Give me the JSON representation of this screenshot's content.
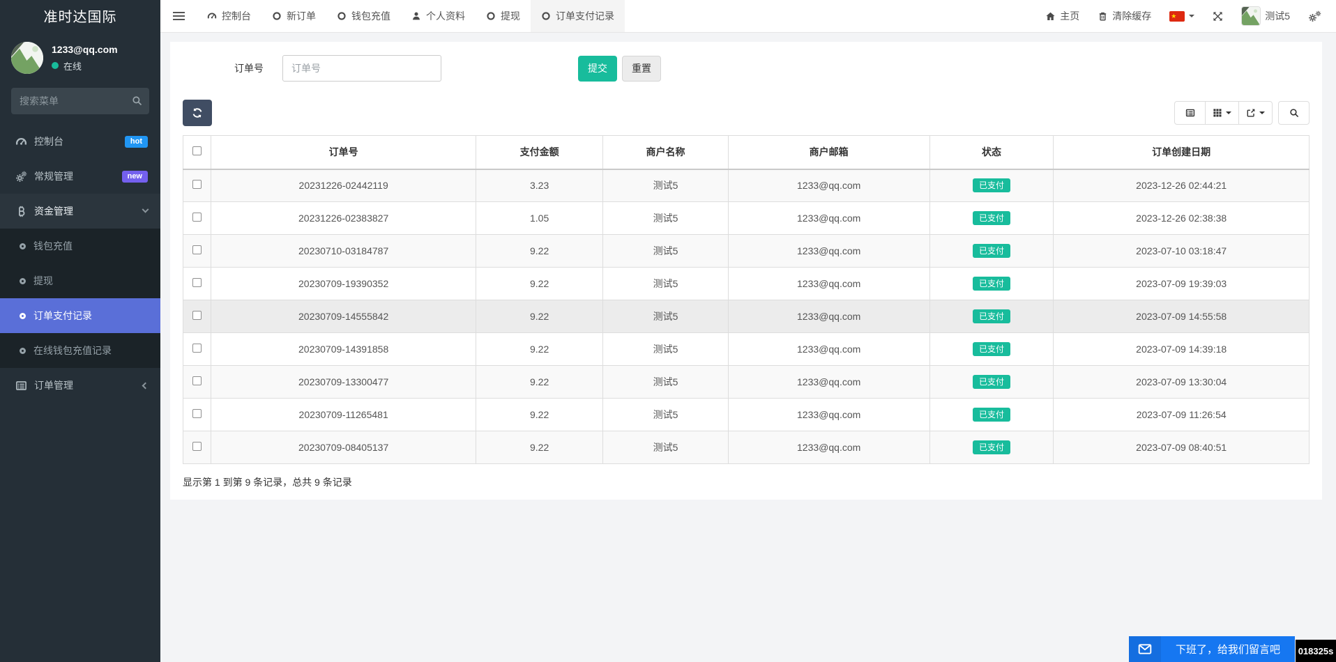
{
  "sidebar": {
    "brand": "准时达国际",
    "user": {
      "name": "1233@qq.com",
      "status": "在线",
      "avatar_icon": "image-placeholder-avatar"
    },
    "search": {
      "placeholder": "搜索菜单",
      "icon": "search-icon"
    },
    "menu": [
      {
        "label": "控制台",
        "icon": "dashboard-icon",
        "badge": "hot",
        "badge_color": "#2196f3"
      },
      {
        "label": "常规管理",
        "icon": "gears-icon",
        "badge": "new",
        "badge_color": "#7460ee"
      },
      {
        "label": "资金管理",
        "icon": "bitcoin-icon",
        "expanded": true
      },
      {
        "label": "订单管理",
        "icon": "order-list-icon",
        "collapsed": true
      }
    ],
    "submenu": [
      {
        "label": "钱包充值",
        "icon": "circle-icon"
      },
      {
        "label": "提现",
        "icon": "circle-icon"
      },
      {
        "label": "订单支付记录",
        "icon": "circle-icon",
        "active": true
      },
      {
        "label": "在线钱包充值记录",
        "icon": "circle-icon"
      }
    ]
  },
  "navbar": {
    "tabs": [
      {
        "label": "控制台",
        "icon": "dashboard-icon"
      },
      {
        "label": "新订单",
        "icon": "circle-icon"
      },
      {
        "label": "钱包充值",
        "icon": "circle-icon"
      },
      {
        "label": "个人资料",
        "icon": "user-icon"
      },
      {
        "label": "提现",
        "icon": "circle-icon"
      },
      {
        "label": "订单支付记录",
        "icon": "circle-icon",
        "active": true
      }
    ],
    "right": {
      "home": {
        "label": "主页",
        "icon": "home-icon"
      },
      "clear_cache": {
        "label": "清除缓存",
        "icon": "trash-icon"
      },
      "language": {
        "icon": "cn-flag-icon",
        "caret": "caret-down-icon"
      },
      "fullscreen": {
        "icon": "fullscreen-expand-icon"
      },
      "user": {
        "label": "测试5",
        "icon": "image-placeholder-avatar"
      },
      "settings": {
        "icon": "gears-icon"
      }
    }
  },
  "filter_form": {
    "label": "订单号",
    "value": "",
    "placeholder": "订单号",
    "submit": "提交",
    "reset": "重置"
  },
  "toolbar": {
    "refresh": {
      "icon": "refresh-icon"
    },
    "view_buttons": [
      {
        "icon": "list-view-icon"
      },
      {
        "icon": "columns-grid-icon",
        "caret": true
      },
      {
        "icon": "export-icon",
        "caret": true
      },
      {
        "icon": "search-icon"
      }
    ]
  },
  "table": {
    "columns": [
      "订单号",
      "支付金额",
      "商户名称",
      "商户邮箱",
      "状态",
      "订单创建日期"
    ],
    "rows": [
      {
        "order_no": "20231226-02442119",
        "amount": "3.23",
        "merchant": "测试5",
        "email": "1233@qq.com",
        "status": "已支付",
        "created": "2023-12-26 02:44:21"
      },
      {
        "order_no": "20231226-02383827",
        "amount": "1.05",
        "merchant": "测试5",
        "email": "1233@qq.com",
        "status": "已支付",
        "created": "2023-12-26 02:38:38"
      },
      {
        "order_no": "20230710-03184787",
        "amount": "9.22",
        "merchant": "测试5",
        "email": "1233@qq.com",
        "status": "已支付",
        "created": "2023-07-10 03:18:47"
      },
      {
        "order_no": "20230709-19390352",
        "amount": "9.22",
        "merchant": "测试5",
        "email": "1233@qq.com",
        "status": "已支付",
        "created": "2023-07-09 19:39:03"
      },
      {
        "order_no": "20230709-14555842",
        "amount": "9.22",
        "merchant": "测试5",
        "email": "1233@qq.com",
        "status": "已支付",
        "created": "2023-07-09 14:55:58"
      },
      {
        "order_no": "20230709-14391858",
        "amount": "9.22",
        "merchant": "测试5",
        "email": "1233@qq.com",
        "status": "已支付",
        "created": "2023-07-09 14:39:18"
      },
      {
        "order_no": "20230709-13300477",
        "amount": "9.22",
        "merchant": "测试5",
        "email": "1233@qq.com",
        "status": "已支付",
        "created": "2023-07-09 13:30:04"
      },
      {
        "order_no": "20230709-11265481",
        "amount": "9.22",
        "merchant": "测试5",
        "email": "1233@qq.com",
        "status": "已支付",
        "created": "2023-07-09 11:26:54"
      },
      {
        "order_no": "20230709-08405137",
        "amount": "9.22",
        "merchant": "测试5",
        "email": "1233@qq.com",
        "status": "已支付",
        "created": "2023-07-09 08:40:51"
      }
    ],
    "hovered_row_index": 4,
    "summary": "显示第 1 到第 9 条记录，总共 9 条记录"
  },
  "chat": {
    "message": "下班了，给我们留言吧",
    "icon": "envelope-icon",
    "timer": "018325s"
  },
  "colors": {
    "sidebar_bg": "#252f37",
    "submenu_bg": "#1b2328",
    "active_menu_blue": "#5a6fd8",
    "accent_green": "#18bc9c",
    "badge_hot_blue": "#2196f3",
    "badge_new_purple": "#7460ee",
    "refresh_button_navy": "#404d63",
    "chat_bar_blue": "#1677f1",
    "flag_red": "#de2910"
  }
}
